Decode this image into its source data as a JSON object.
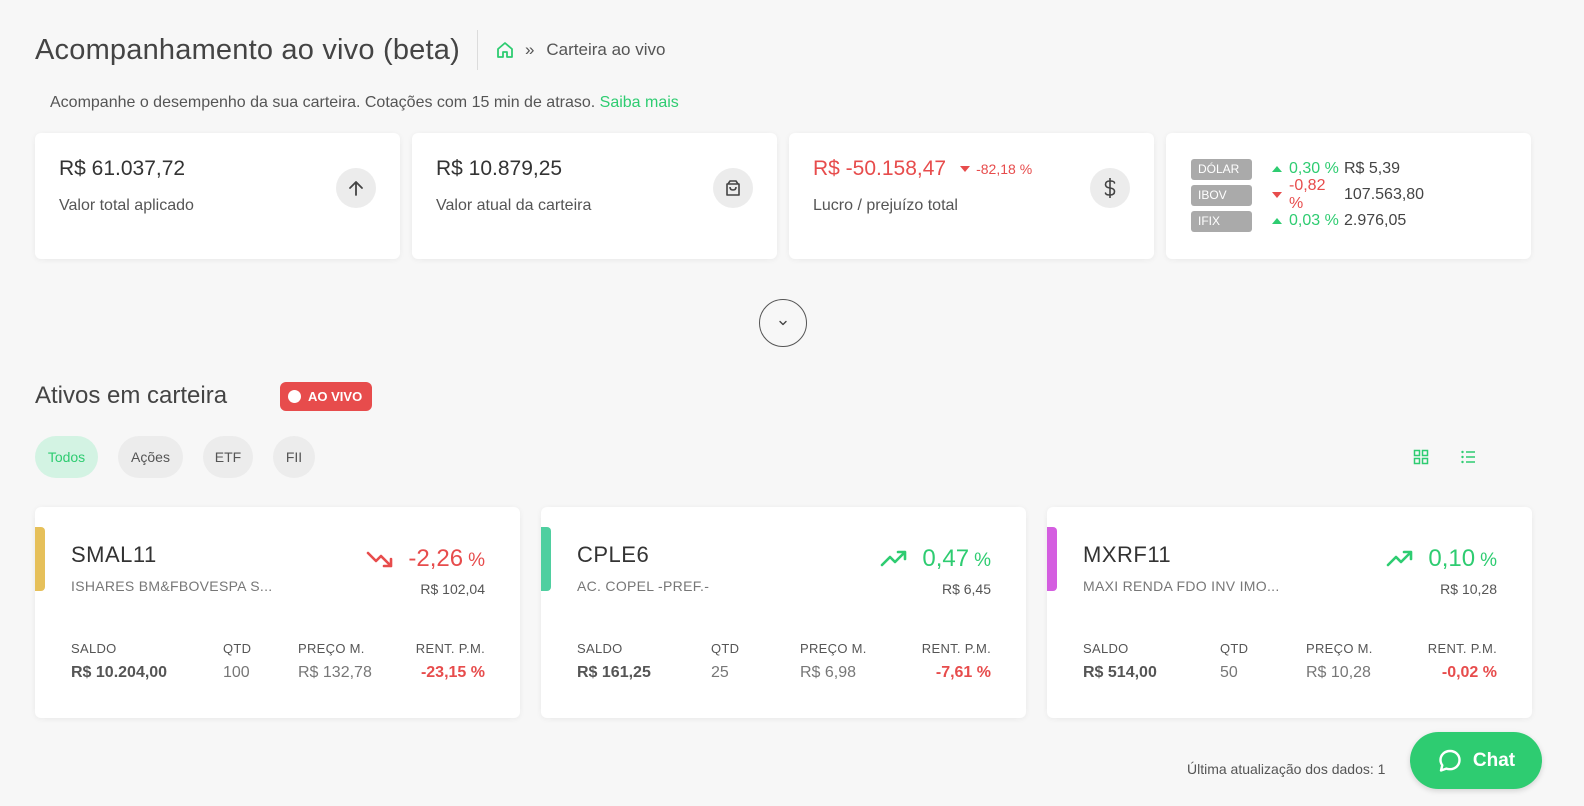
{
  "header": {
    "title": "Acompanhamento ao vivo (beta)",
    "breadcrumb_separator": "»",
    "breadcrumb_current": "Carteira ao vivo"
  },
  "subtitle": {
    "text": "Acompanhe o desempenho da sua carteira. Cotações com 15 min de atraso.",
    "link": "Saiba mais"
  },
  "summary": {
    "invested": {
      "value": "R$ 61.037,72",
      "label": "Valor total aplicado"
    },
    "current": {
      "value": "R$ 10.879,25",
      "label": "Valor atual da carteira"
    },
    "profit": {
      "value": "R$ -50.158,47",
      "pct": "-82,18 %",
      "label": "Lucro / prejuízo total"
    }
  },
  "indices": [
    {
      "name": "DÓLAR",
      "change": "0,30 %",
      "direction": "up",
      "value": "R$ 5,39"
    },
    {
      "name": "IBOV",
      "change": "-0,82 %",
      "direction": "down",
      "value": "107.563,80"
    },
    {
      "name": "IFIX",
      "change": "0,03 %",
      "direction": "up",
      "value": "2.976,05"
    }
  ],
  "section": {
    "title": "Ativos em carteira",
    "live_badge": "AO VIVO"
  },
  "filters": [
    "Todos",
    "Ações",
    "ETF",
    "FII"
  ],
  "stat_labels": {
    "saldo": "SALDO",
    "qtd": "QTD",
    "preco": "PREÇO M.",
    "rent": "RENT. P.M."
  },
  "assets": [
    {
      "ticker": "SMAL11",
      "name": "ISHARES BM&FBOVESPA S...",
      "change": "-2,26",
      "pct_sign": "%",
      "direction": "down",
      "price": "R$ 102,04",
      "accent": "#e6c05a",
      "saldo": "R$ 10.204,00",
      "qtd": "100",
      "preco": "R$ 132,78",
      "rent": "-23,15 %"
    },
    {
      "ticker": "CPLE6",
      "name": "AC. COPEL -PREF.-",
      "change": "0,47",
      "pct_sign": "%",
      "direction": "up",
      "price": "R$ 6,45",
      "accent": "#4fcfa0",
      "saldo": "R$ 161,25",
      "qtd": "25",
      "preco": "R$ 6,98",
      "rent": "-7,61 %"
    },
    {
      "ticker": "MXRF11",
      "name": "MAXI RENDA FDO INV IMO...",
      "change": "0,10",
      "pct_sign": "%",
      "direction": "up",
      "price": "R$ 10,28",
      "accent": "#d45ee0",
      "saldo": "R$ 514,00",
      "qtd": "50",
      "preco": "R$ 10,28",
      "rent": "-0,02 %"
    }
  ],
  "footer": {
    "last_update": "Última atualização dos dados: 1"
  },
  "chat": {
    "label": "Chat"
  },
  "colors": {
    "green": "#2ecc71",
    "red": "#e74c4c"
  }
}
